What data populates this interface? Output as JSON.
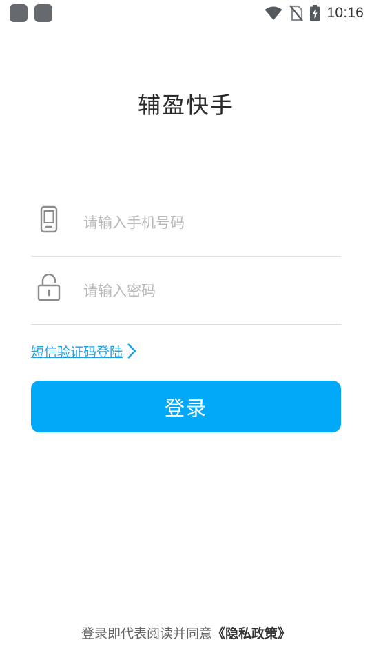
{
  "status_bar": {
    "time": "10:16",
    "icons": [
      "notification-icon",
      "notification-icon",
      "wifi-icon",
      "no-sim-icon",
      "battery-charging-icon"
    ]
  },
  "app": {
    "title": "辅盈快手"
  },
  "form": {
    "phone": {
      "placeholder": "请输入手机号码",
      "value": "",
      "icon": "phone-icon"
    },
    "password": {
      "placeholder": "请输入密码",
      "value": "",
      "icon": "lock-icon"
    },
    "sms_login_label": "短信验证码登陆",
    "login_label": "登录"
  },
  "footer": {
    "agreement_prefix": "登录即代表阅读并同意",
    "policy_link": "《隐私政策》"
  },
  "colors": {
    "accent": "#03a9f9",
    "link": "#1a9fe6",
    "divider": "#dedede",
    "placeholder": "#b8b8b8"
  }
}
